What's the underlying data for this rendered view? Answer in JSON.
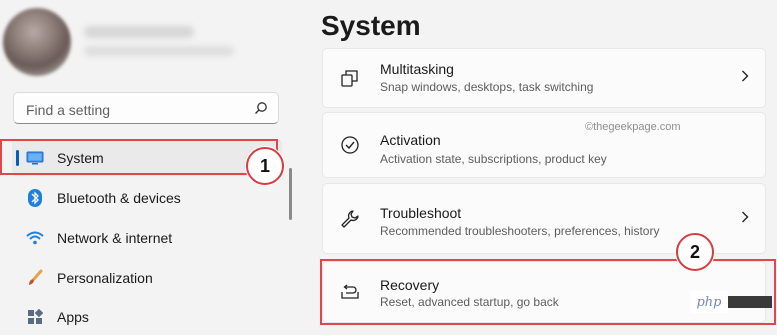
{
  "main": {
    "title": "System",
    "watermark": "©thegeekpage.com",
    "cards": [
      {
        "title": "Multitasking",
        "subtitle": "Snap windows, desktops, task switching",
        "icon": "multitasking-icon"
      },
      {
        "title": "Activation",
        "subtitle": "Activation state, subscriptions, product key",
        "icon": "activation-check-icon"
      },
      {
        "title": "Troubleshoot",
        "subtitle": "Recommended troubleshooters, preferences, history",
        "icon": "wrench-icon"
      },
      {
        "title": "Recovery",
        "subtitle": "Reset, advanced startup, go back",
        "icon": "recovery-icon"
      }
    ]
  },
  "search": {
    "placeholder": "Find a setting",
    "icon": "search-icon"
  },
  "sidebar": {
    "items": [
      {
        "label": "System",
        "icon": "monitor-icon",
        "selected": true
      },
      {
        "label": "Bluetooth & devices",
        "icon": "bluetooth-icon"
      },
      {
        "label": "Network & internet",
        "icon": "wifi-icon"
      },
      {
        "label": "Personalization",
        "icon": "paintbrush-icon"
      },
      {
        "label": "Apps",
        "icon": "apps-icon"
      }
    ]
  },
  "annotations": {
    "step1": "1",
    "step2": "2"
  },
  "overlay": {
    "php_logo": "php"
  },
  "colors": {
    "accent": "#005fb8",
    "highlight": "#e0474c"
  }
}
